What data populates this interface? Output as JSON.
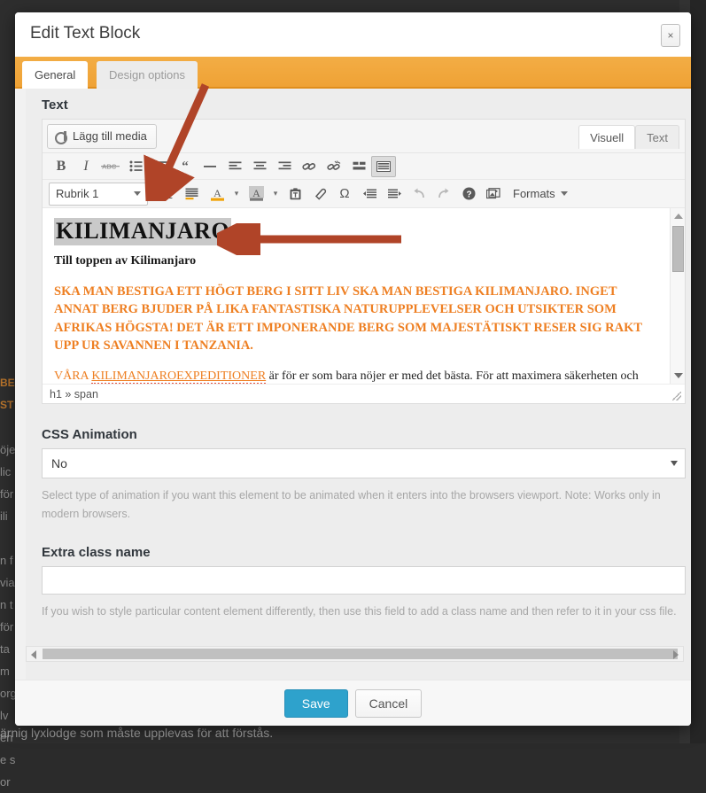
{
  "modal": {
    "title": "Edit Text Block",
    "close_label": "×",
    "tabs": [
      {
        "label": "General",
        "active": true
      },
      {
        "label": "Design options",
        "active": false
      }
    ]
  },
  "editor_section": {
    "label": "Text",
    "add_media_label": "Lägg till media",
    "view_tabs": [
      {
        "label": "Visuell",
        "active": true
      },
      {
        "label": "Text",
        "active": false
      }
    ],
    "toolbar_row1": [
      {
        "name": "bold-icon",
        "glyph": "B",
        "pressed": false
      },
      {
        "name": "italic-icon",
        "glyph": "I",
        "pressed": false
      },
      {
        "name": "strikethrough-icon",
        "glyph": "ABC",
        "pressed": false
      },
      {
        "name": "bulleted-list-icon",
        "glyph": "☰",
        "pressed": false
      },
      {
        "name": "numbered-list-icon",
        "glyph": "☰",
        "pressed": false
      },
      {
        "name": "blockquote-icon",
        "glyph": "❝",
        "pressed": false
      },
      {
        "name": "horizontal-rule-icon",
        "glyph": "—",
        "pressed": false
      },
      {
        "name": "align-left-icon",
        "glyph": "☰",
        "pressed": false
      },
      {
        "name": "align-center-icon",
        "glyph": "☰",
        "pressed": false
      },
      {
        "name": "align-right-icon",
        "glyph": "☰",
        "pressed": false
      },
      {
        "name": "insert-link-icon",
        "glyph": "🔗",
        "pressed": false
      },
      {
        "name": "remove-link-icon",
        "glyph": "🔗",
        "pressed": false
      },
      {
        "name": "insert-read-more-icon",
        "glyph": "▤",
        "pressed": false
      },
      {
        "name": "kitchen-sink-icon",
        "glyph": "▤",
        "pressed": true
      }
    ],
    "format_select_value": "Rubrik 1",
    "toolbar_row2": [
      {
        "name": "underline-icon",
        "glyph": "U"
      },
      {
        "name": "justify-icon",
        "glyph": "☰"
      },
      {
        "name": "text-color-icon",
        "glyph": "A"
      },
      {
        "name": "text-color-dropdown-icon",
        "glyph": "▾"
      },
      {
        "name": "background-color-icon",
        "glyph": "A"
      },
      {
        "name": "background-color-dropdown-icon",
        "glyph": "▾"
      },
      {
        "name": "paste-as-text-icon",
        "glyph": "📋"
      },
      {
        "name": "clear-formatting-icon",
        "glyph": "◇"
      },
      {
        "name": "special-character-icon",
        "glyph": "Ω"
      },
      {
        "name": "decrease-indent-icon",
        "glyph": "⇤"
      },
      {
        "name": "increase-indent-icon",
        "glyph": "⇥"
      },
      {
        "name": "undo-icon",
        "glyph": "↶"
      },
      {
        "name": "redo-icon",
        "glyph": "↷"
      },
      {
        "name": "keyboard-shortcuts-icon",
        "glyph": "?"
      },
      {
        "name": "insert-image-icon",
        "glyph": "🖼"
      }
    ],
    "formats_label": "Formats",
    "document": {
      "heading": "KILIMANJARO",
      "subheading": "Till toppen av Kilimanjaro",
      "caps_paragraph": "SKA MAN BESTIGA ETT HÖGT BERG I SITT LIV SKA MAN BESTIGA KILIMANJARO. INGET ANNAT BERG BJUDER PÅ LIKA FANTASTISKA NATURUPPLEVELSER OCH UTSIKTER SOM AFRIKAS HÖGSTA! DET ÄR ETT IMPONERANDE BERG SOM MAJESTÄTISKT RESER SIG RAKT UPP UR SAVANNEN I TANZANIA.",
      "last_paragraph_prefix": "VÅRA ",
      "last_paragraph_link": "KILIMANJAROEXPEDITIONER",
      "last_paragraph_rest": " är för er som bara nöjer er med det bästa. För att maximera säkerheten och"
    },
    "path_bar": "h1 » span"
  },
  "css_animation": {
    "label": "CSS Animation",
    "value": "No",
    "help": "Select type of animation if you want this element to be animated when it enters into the browsers viewport. Note: Works only in modern browsers."
  },
  "extra_class": {
    "label": "Extra class name",
    "value": "",
    "placeholder": "",
    "help": "If you wish to style particular content element differently, then use this field to add a class name and then refer to it in your css file."
  },
  "footer": {
    "save_label": "Save",
    "cancel_label": "Cancel"
  },
  "background": {
    "left_fragments": [
      "BE",
      "ST",
      "",
      "öje",
      "lic",
      "för",
      "ili",
      "",
      "n f",
      "via",
      "n t",
      "för",
      "ta",
      "m",
      "org",
      "lv",
      "en",
      "e s",
      "or"
    ],
    "bottom_line": "ärnig lyxlodge som måste upplevas för att förstås."
  },
  "colors": {
    "accent_orange": "#efa235",
    "save_blue": "#2ea2cc",
    "annotation_red": "#b04428",
    "doc_orange": "#ee7f22",
    "backdrop": "#2e2e2e"
  }
}
